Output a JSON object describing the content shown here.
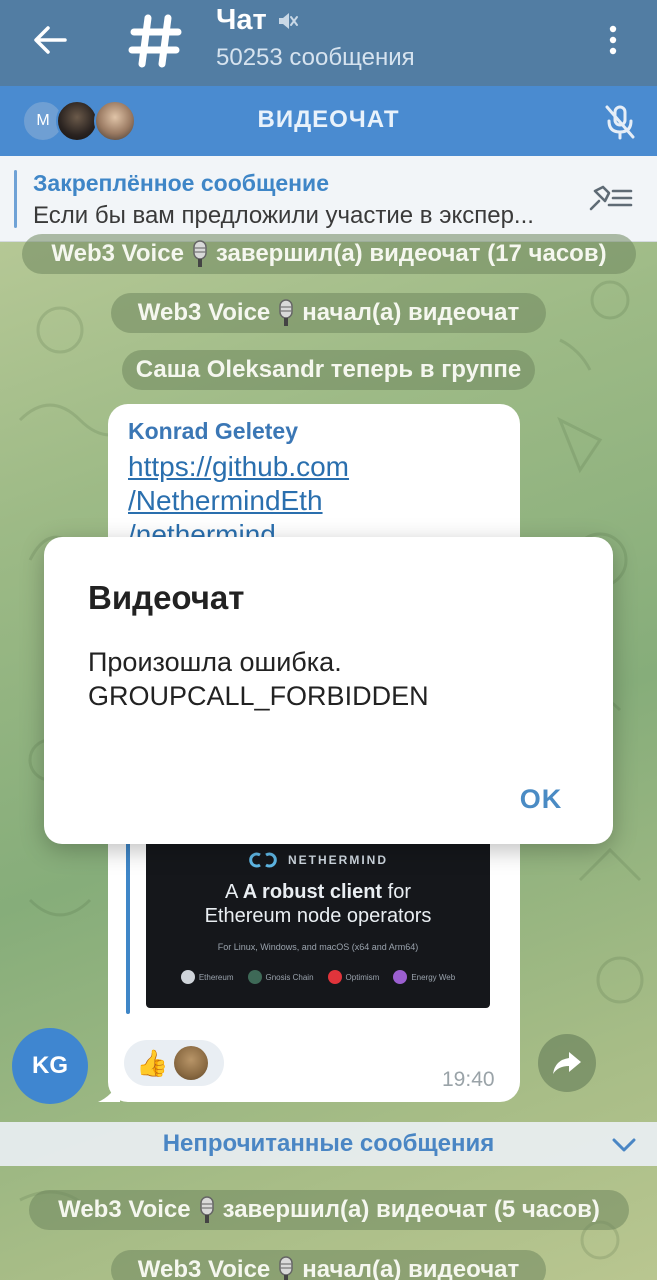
{
  "header": {
    "title": "Чат",
    "subtitle": "50253 сообщения"
  },
  "videochat_bar": {
    "label": "ВИДЕОЧАТ",
    "first_avatar_letter": "M"
  },
  "pinned": {
    "title": "Закреплённое сообщение",
    "text": "Если бы вам предложили участие в экспер..."
  },
  "service_messages": [
    {
      "before": "Web3 Voice",
      "after": "завершил(а) видеочат (17 часов)"
    },
    {
      "before": "Web3 Voice",
      "after": "начал(а) видеочат"
    },
    {
      "before": "",
      "after": "Саша Oleksandr теперь в группе"
    },
    {
      "before": "Web3 Voice",
      "after": "завершил(а) видеочат (5 часов)"
    },
    {
      "before": "Web3 Voice",
      "after": "начал(а) видеочат"
    }
  ],
  "message": {
    "sender": "Konrad Geletey",
    "link_lines": [
      "https://github.com",
      "/NethermindEth",
      "/nethermind"
    ],
    "preview": {
      "brand": "NETHERMIND",
      "headline_bold": "A robust client",
      "headline_rest": " for",
      "headline_line2": "Ethereum node operators",
      "subline": "For Linux, Windows, and macOS (x64 and Arm64)",
      "networks": [
        "Ethereum",
        "Gnosis Chain",
        "Optimism",
        "Energy Web"
      ]
    },
    "reaction_emoji": "👍",
    "time": "19:40",
    "avatar_initials": "KG"
  },
  "unread_divider": "Непрочитанные сообщения",
  "dialog": {
    "title": "Видеочат",
    "message_line1": "Произошла ошибка.",
    "message_line2": "GROUPCALL_FORBIDDEN",
    "ok_label": "OK"
  },
  "colors": {
    "header_bg": "#527da3",
    "videochat_bar_bg": "#4a8bd0",
    "accent_blue": "#3f86c7",
    "dialog_ok": "#4a8bc4"
  }
}
